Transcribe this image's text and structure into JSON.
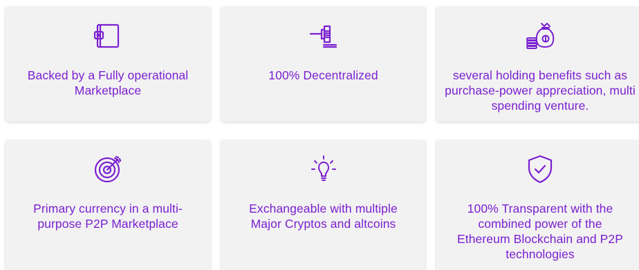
{
  "accent_color": "#7a1fd0",
  "cards": [
    {
      "icon": "wallet-icon",
      "text": "Backed by a Fully operational Marketplace"
    },
    {
      "icon": "gavel-icon",
      "text": "100% Decentralized"
    },
    {
      "icon": "money-bag-icon",
      "text": "several holding benefits such as purchase-power appreciation, multi spending venture."
    },
    {
      "icon": "target-icon",
      "text": "Primary currency in a multi-purpose P2P Marketplace"
    },
    {
      "icon": "lightbulb-icon",
      "text": "Exchangeable with multiple Major Cryptos and altcoins"
    },
    {
      "icon": "shield-check-icon",
      "text": "100% Transparent with the combined power of the Ethereum Blockchain and P2P technologies"
    }
  ]
}
